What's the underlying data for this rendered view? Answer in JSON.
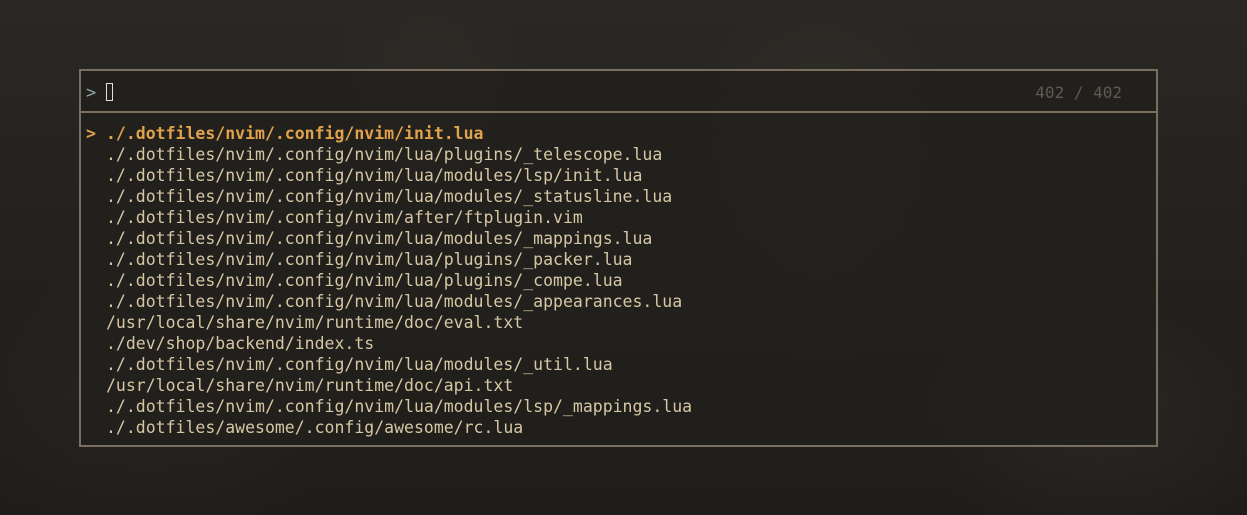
{
  "prompt": {
    "symbol": ">",
    "query": "",
    "counter": "402 / 402"
  },
  "results": {
    "selected_marker": ">",
    "items": [
      "./.dotfiles/nvim/.config/nvim/init.lua",
      "./.dotfiles/nvim/.config/nvim/lua/plugins/_telescope.lua",
      "./.dotfiles/nvim/.config/nvim/lua/modules/lsp/init.lua",
      "./.dotfiles/nvim/.config/nvim/lua/modules/_statusline.lua",
      "./.dotfiles/nvim/.config/nvim/after/ftplugin.vim",
      "./.dotfiles/nvim/.config/nvim/lua/modules/_mappings.lua",
      "./.dotfiles/nvim/.config/nvim/lua/plugins/_packer.lua",
      "./.dotfiles/nvim/.config/nvim/lua/plugins/_compe.lua",
      "./.dotfiles/nvim/.config/nvim/lua/modules/_appearances.lua",
      "/usr/local/share/nvim/runtime/doc/eval.txt",
      "./dev/shop/backend/index.ts",
      "./.dotfiles/nvim/.config/nvim/lua/modules/_util.lua",
      "/usr/local/share/nvim/runtime/doc/api.txt",
      "./.dotfiles/nvim/.config/nvim/lua/modules/lsp/_mappings.lua",
      "./.dotfiles/awesome/.config/awesome/rc.lua"
    ]
  },
  "colors": {
    "border": "#7a6f5e",
    "selected": "#e0a24a",
    "text": "#d6c7a4",
    "prompt_symbol": "#8fa6a8",
    "counter": "#5f5a52"
  }
}
